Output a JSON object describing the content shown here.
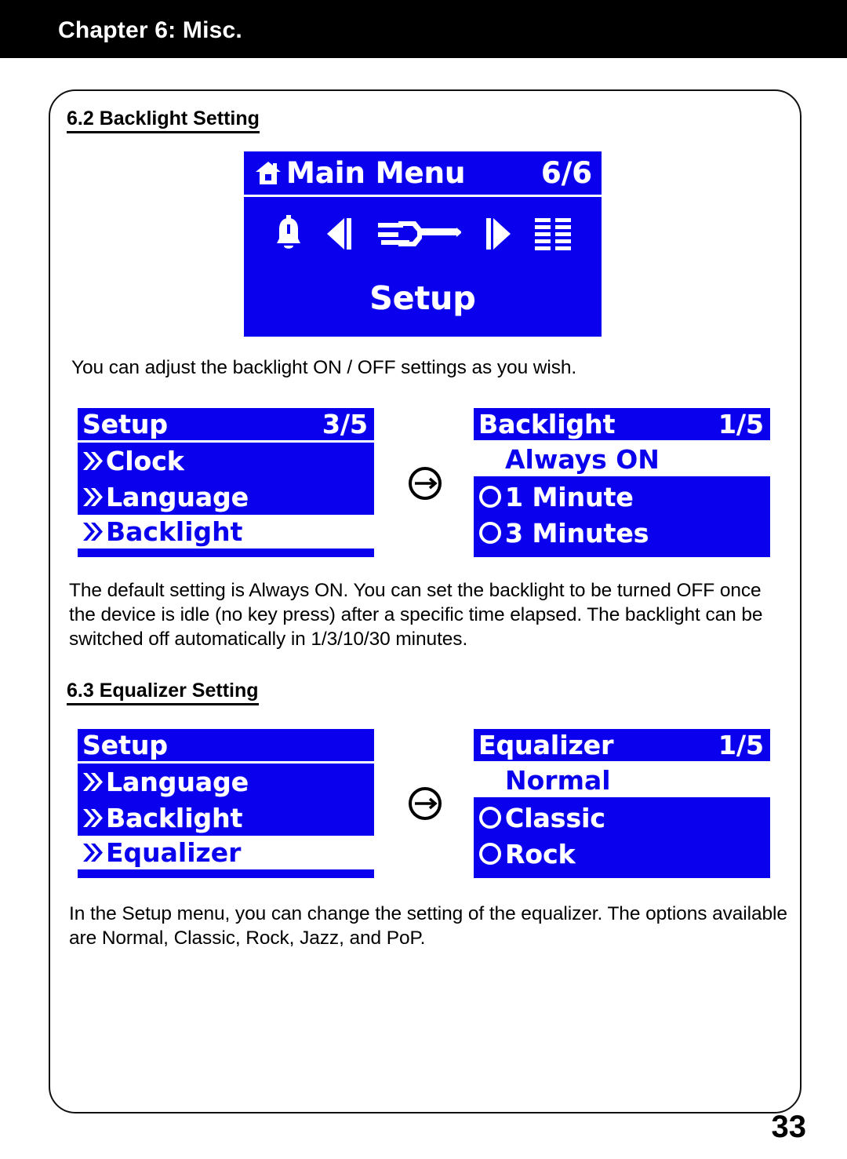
{
  "chapter": {
    "title": "Chapter 6: Misc."
  },
  "page": {
    "number": "33"
  },
  "sections": {
    "backlight": {
      "heading": "6.2 Backlight Setting",
      "intro_paragraph": "You can adjust the backlight ON / OFF settings as you wish.",
      "detail_paragraph": "The default setting is Always ON. You can set the backlight to be turned OFF once the device is idle (no key press) after a specific time elapsed. The backlight can be switched off automatically in 1/3/10/30 minutes."
    },
    "equalizer": {
      "heading": "6.3 Equalizer Setting",
      "paragraph": "In the Setup menu, you can change the setting of the equalizer. The options available are Normal, Classic, Rock, Jazz, and PoP."
    }
  },
  "screens": {
    "main_menu": {
      "header_title": "Main Menu",
      "header_count": "6/6",
      "home_icon": "home-icon",
      "icons": [
        "bell-icon",
        "arrow-left-icon",
        "wrench-screwdriver-icon",
        "arrow-right-icon",
        "list-icon"
      ],
      "selected_label": "Setup"
    },
    "setup_backlight": {
      "header_title": "Setup",
      "header_count": "3/5",
      "rows": [
        {
          "label": "Clock",
          "icon": "double-chevron-icon",
          "selected": false
        },
        {
          "label": "Language",
          "icon": "double-chevron-icon",
          "selected": false
        },
        {
          "label": "Backlight",
          "icon": "double-chevron-icon",
          "selected": true
        }
      ]
    },
    "backlight": {
      "header_title": "Backlight",
      "header_count": "1/5",
      "rows": [
        {
          "label": "Always ON",
          "icon": "radio-filled-icon",
          "selected": true
        },
        {
          "label": "1 Minute",
          "icon": "radio-empty-icon",
          "selected": false
        },
        {
          "label": "3 Minutes",
          "icon": "radio-empty-icon",
          "selected": false
        }
      ]
    },
    "setup_equalizer": {
      "header_title": "Setup",
      "header_count": "",
      "rows": [
        {
          "label": "Language",
          "icon": "double-chevron-icon",
          "selected": false
        },
        {
          "label": "Backlight",
          "icon": "double-chevron-icon",
          "selected": false
        },
        {
          "label": "Equalizer",
          "icon": "double-chevron-icon",
          "selected": true
        }
      ]
    },
    "equalizer": {
      "header_title": "Equalizer",
      "header_count": "1/5",
      "rows": [
        {
          "label": "Normal",
          "icon": "radio-filled-icon",
          "selected": true
        },
        {
          "label": "Classic",
          "icon": "radio-empty-icon",
          "selected": false
        },
        {
          "label": "Rock",
          "icon": "radio-empty-icon",
          "selected": false
        }
      ]
    }
  },
  "transitions": {
    "arrow_icon": "circled-arrow-right-icon"
  },
  "colors": {
    "lcd_background": "#0b00ee",
    "lcd_foreground": "#ffffff",
    "header_bar": "#000000",
    "text": "#000000"
  }
}
